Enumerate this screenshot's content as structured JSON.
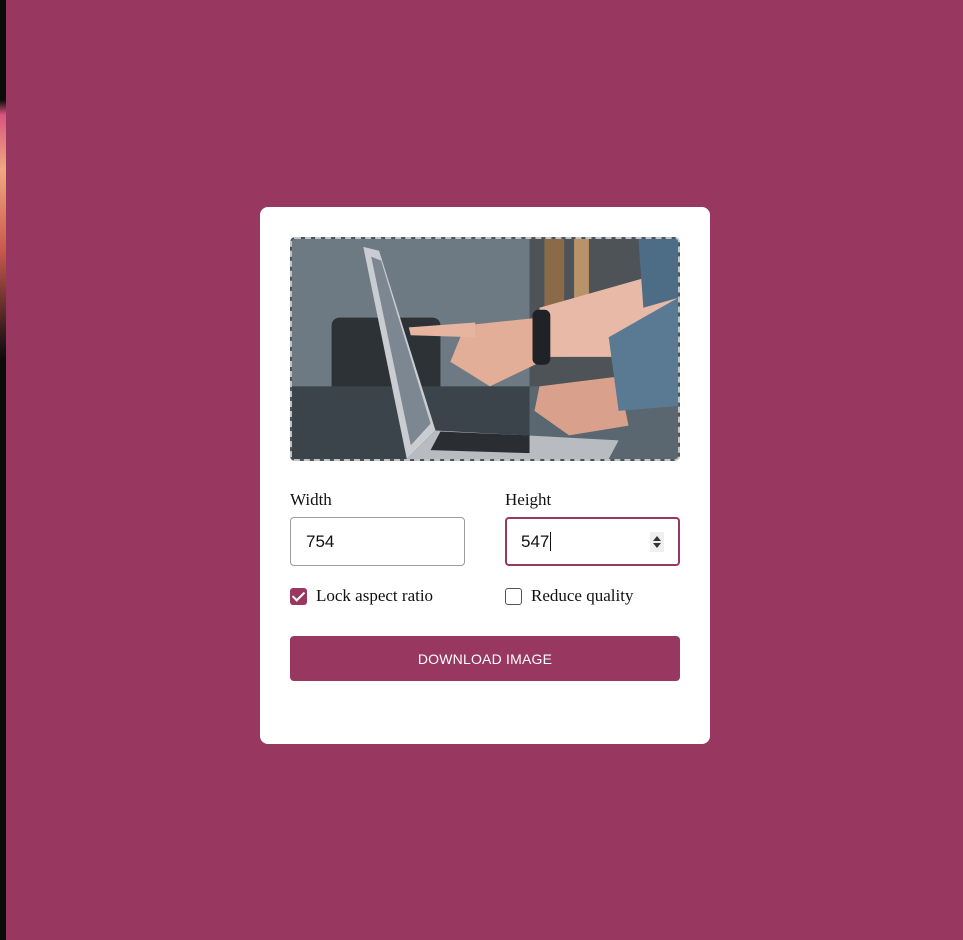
{
  "preview": {
    "image_icon": "image-preview"
  },
  "width": {
    "label": "Width",
    "value": "754"
  },
  "height": {
    "label": "Height",
    "value": "547"
  },
  "options": {
    "lock_aspect_label": "Lock aspect ratio",
    "lock_aspect_checked": true,
    "reduce_quality_label": "Reduce quality",
    "reduce_quality_checked": false
  },
  "download_button_label": "DOWNLOAD IMAGE",
  "colors": {
    "accent": "#98375f",
    "card": "#ffffff",
    "input_border": "#9c9c9c",
    "preview_border": "#c4c4c4"
  }
}
